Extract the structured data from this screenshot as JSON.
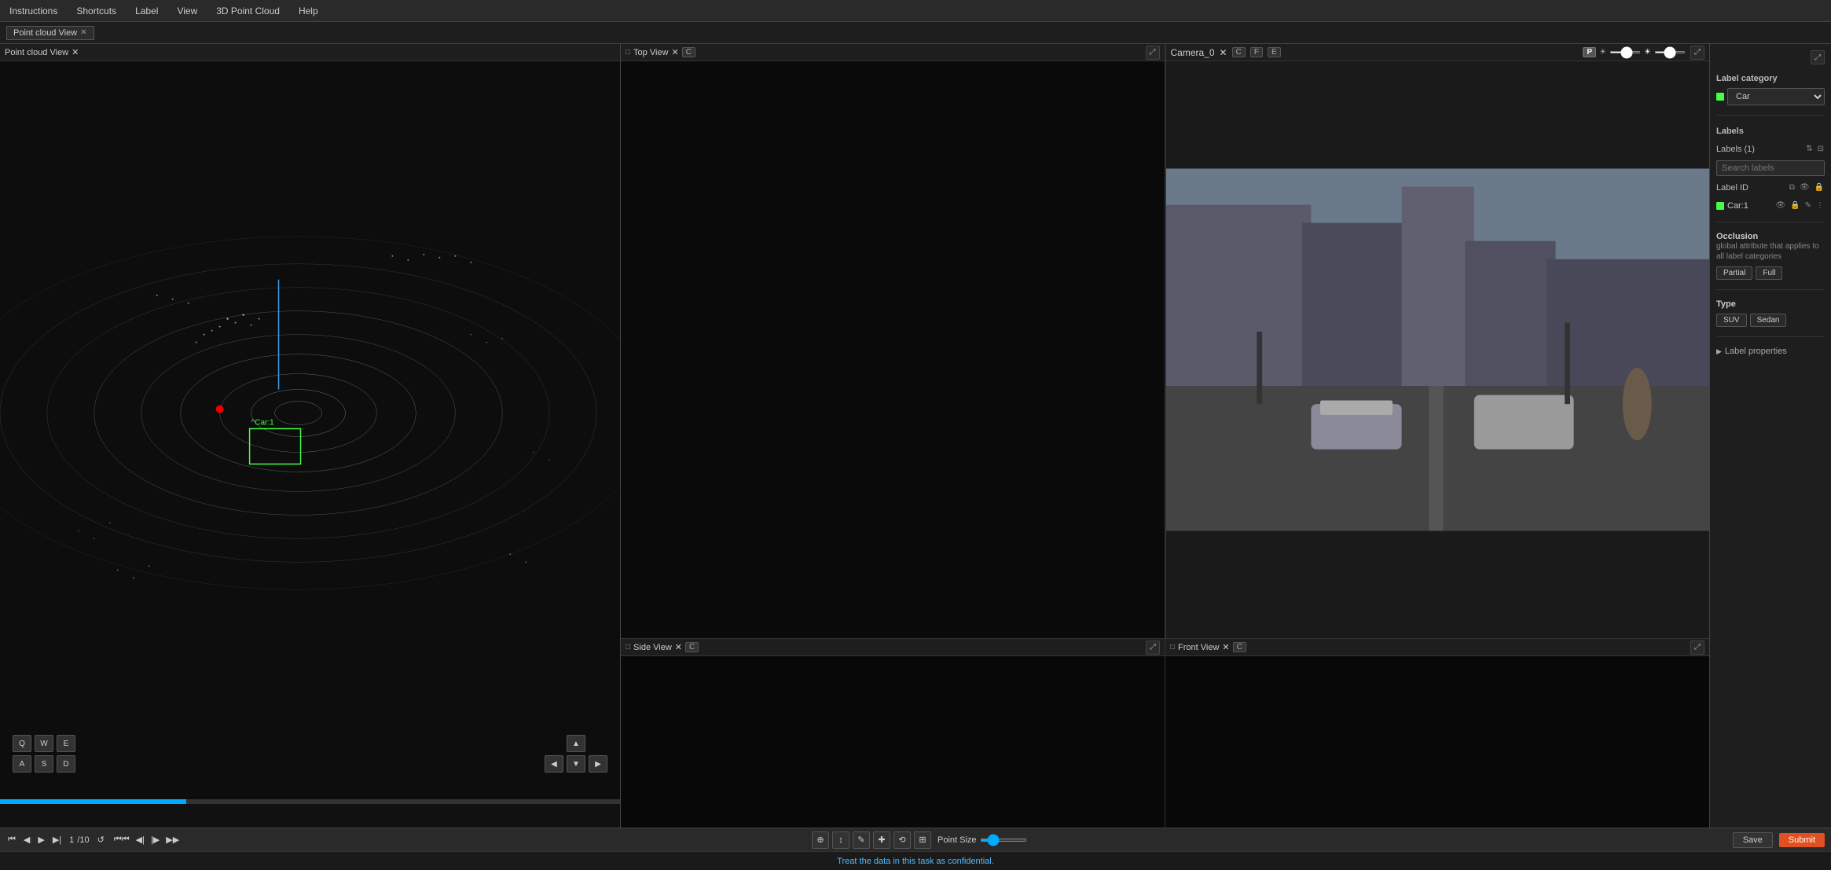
{
  "menu": {
    "items": [
      "Instructions",
      "Shortcuts",
      "Label",
      "View",
      "3D Point Cloud",
      "Help"
    ]
  },
  "tabs": {
    "main_tab": "Point cloud View",
    "top_view": "Top View",
    "camera_tab": "Camera_0"
  },
  "views": {
    "top_view": {
      "title": "Top View",
      "badge": "C"
    },
    "side_view": {
      "title": "Side View",
      "badge": "C"
    },
    "front_view": {
      "title": "Front View",
      "badge": "C"
    },
    "camera": {
      "title": "Camera_0",
      "badges": [
        "C",
        "F",
        "E"
      ]
    }
  },
  "label_panel": {
    "category_title": "Label category",
    "category_value": "Car",
    "labels_title": "Labels",
    "labels_count": "Labels (1)",
    "search_placeholder": "Search labels",
    "label_id_title": "Label ID",
    "label_item": "Car:1",
    "occlusion_title": "Occlusion",
    "occlusion_desc": "global attribute that applies to all label categories",
    "partial_btn": "Partial",
    "full_btn": "Full",
    "type_title": "Type",
    "suv_btn": "SUV",
    "sedan_btn": "Sedan",
    "label_properties": "Label properties"
  },
  "toolbar": {
    "point_size_label": "Point Size",
    "save_btn": "Save",
    "submit_btn": "Submit",
    "frame_current": "1",
    "frame_total": "/10"
  },
  "status_bar": {
    "message": "Treat the data in this task as confidential."
  },
  "keyboard": {
    "row1": [
      "Q",
      "W",
      "E"
    ],
    "row2": [
      "A",
      "S",
      "D"
    ]
  }
}
